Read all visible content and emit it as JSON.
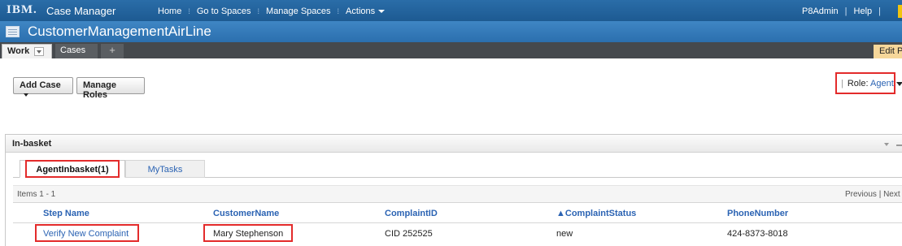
{
  "app": {
    "brand": "IBM.",
    "product": "Case Manager",
    "solution_title": "CustomerManagementAirLine"
  },
  "topnav": {
    "items": [
      {
        "label": "Home"
      },
      {
        "label": "Go to Spaces"
      },
      {
        "label": "Manage Spaces"
      },
      {
        "label": "Actions"
      }
    ],
    "user": "P8Admin",
    "help": "Help",
    "sep": "|"
  },
  "tabs": {
    "work": "Work",
    "cases": "Cases",
    "add": "+",
    "edit_page": "Edit Page"
  },
  "toolbar": {
    "add_case": "Add Case",
    "manage_roles": "Manage Roles"
  },
  "role": {
    "label": "Role:",
    "value": "Agent"
  },
  "inbasket": {
    "title": "In-basket",
    "tabs": [
      {
        "label": "AgentInbasket(1)"
      },
      {
        "label": "MyTasks"
      }
    ],
    "items_count": "Items 1 - 1",
    "pager": {
      "previous": "Previous",
      "sep": "|",
      "next": "Next"
    },
    "columns": [
      "Step Name",
      "CustomerName",
      "ComplaintID",
      "▲ComplaintStatus",
      "PhoneNumber"
    ],
    "rows": [
      {
        "step_name": "Verify New Complaint",
        "customer_name": "Mary Stephenson",
        "complaint_id": "CID 252525",
        "complaint_status": "new",
        "phone_number": "424-8373-8018"
      }
    ]
  },
  "colors": {
    "header_blue": "#1d5a92",
    "solution_blue": "#2b6fae",
    "tab_dark": "#45494d",
    "link_blue": "#2b63b3",
    "highlight_red": "#e32b2b",
    "edit_page_bg": "#f6d79a"
  }
}
